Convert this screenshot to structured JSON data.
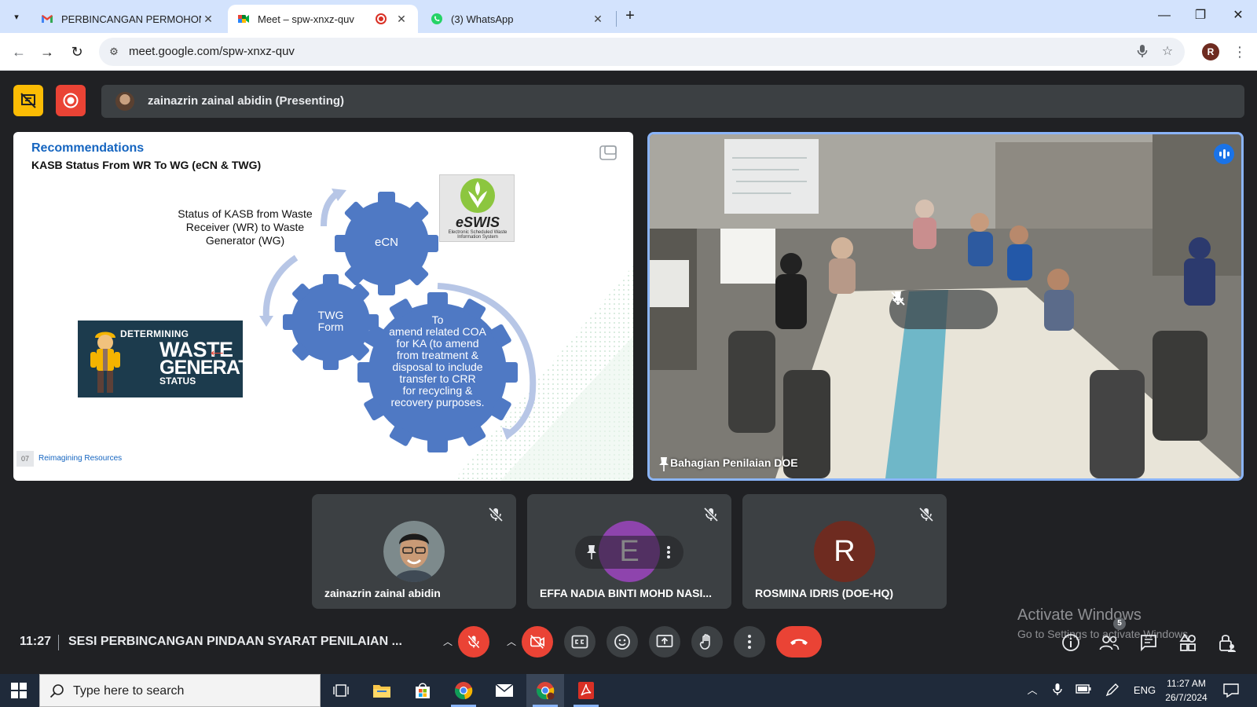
{
  "browser": {
    "tabs": [
      {
        "title": "PERBINCANGAN PERMOHONA",
        "favicon": "gmail-icon",
        "active": false
      },
      {
        "title": "Meet – spw-xnxz-quv",
        "favicon": "meet-icon",
        "active": true,
        "recording": true
      },
      {
        "title": "(3) WhatsApp",
        "favicon": "whatsapp-icon",
        "active": false
      }
    ],
    "new_tab": "+",
    "url": "meet.google.com/spw-xnxz-quv",
    "profile_initial": "R"
  },
  "meet": {
    "presenter_bar": "zainazrin zainal abidin (Presenting)",
    "slide": {
      "title": "Recommendations",
      "subtitle": "KASB Status From WR To WG (eCN & TWG)",
      "status_text": "Status of KASB from Waste Receiver (WR) to Waste Generator (WG)",
      "gears": {
        "ecn": "eCN",
        "twg_line1": "TWG",
        "twg_line2": "Form",
        "big": [
          "To",
          "amend related COA",
          "for KA (to amend",
          "from treatment &",
          "disposal to include",
          "transfer to CRR",
          "for recycling &",
          "recovery purposes."
        ]
      },
      "eswis": {
        "brand": "eSWIS",
        "tagline": "Electronic Scheduled Waste Information System"
      },
      "banner": {
        "line1": "DETERMINING",
        "line2": "WASTE",
        "line3": "GENERATOR",
        "line4": "STATUS"
      },
      "footer_num": "07",
      "footer_text": "Reimagining Resources"
    },
    "main_tile_name": "Bahagian Penilaian DOE",
    "participants": [
      {
        "name": "zainazrin zainal abidin",
        "avatar": "photo"
      },
      {
        "name": "EFFA NADIA BINTI MOHD NASI...",
        "avatar_letter": "E",
        "avatar_color": "#8e44ad"
      },
      {
        "name": "ROSMINA IDRIS (DOE-HQ)",
        "avatar_letter": "R",
        "avatar_color": "#6e2b20"
      }
    ],
    "clock": "11:27",
    "meeting_title": "SESI PERBINCANGAN PINDAAN SYARAT PENILAIAN ...",
    "people_count": "5",
    "watermark": {
      "line1": "Activate Windows",
      "line2": "Go to Settings to activate Windows."
    },
    "colors": {
      "accent": "#8ab4f8",
      "danger": "#ea4335",
      "surface": "#3c4043",
      "background": "#202124",
      "host_control": "#fbbc04"
    }
  },
  "taskbar": {
    "search_placeholder": "Type here to search",
    "language": "ENG",
    "time": "11:27 AM",
    "date": "26/7/2024"
  }
}
